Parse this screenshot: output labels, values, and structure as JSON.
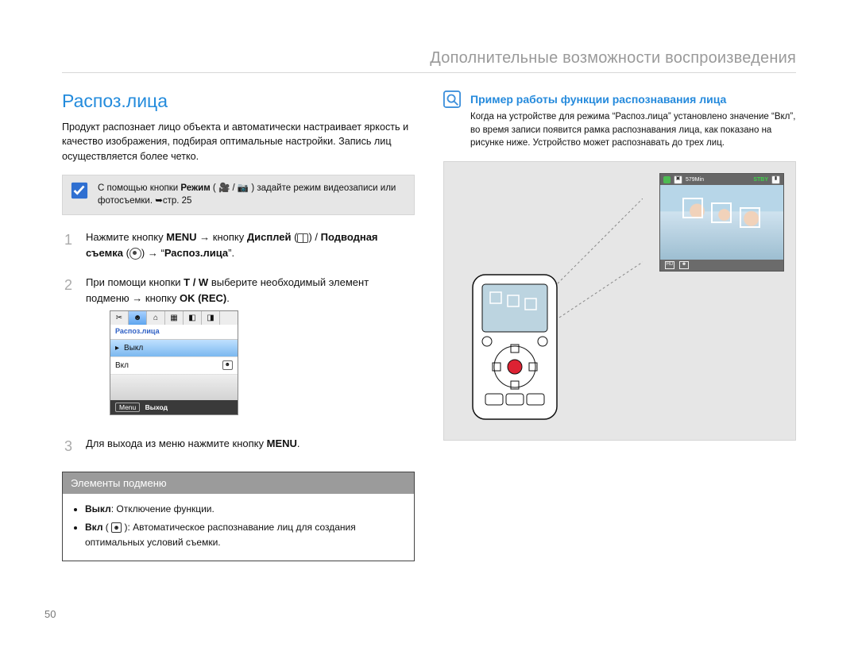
{
  "header": "Дополнительные возможности воспроизведения",
  "section_title": "Распоз.лица",
  "intro": "Продукт распознает лицо объекта и автоматически настраивает яркость и качество изображения, подбирая оптимальные настройки. Запись лиц осуществляется более четко.",
  "mode_note": {
    "prefix": "С помощью кнопки ",
    "bold1": "Режим",
    "glyph": " ( 🎥 / 📷 ) ",
    "rest": "задайте режим видеозаписи или фотосъемки. ➥стр. 25"
  },
  "steps": [
    {
      "num": "1",
      "parts": {
        "p1": "Нажмите кнопку ",
        "b1": "MENU",
        "p2": " → кнопку ",
        "b2": "Дисплей",
        "icon1": "display-icon",
        "p3": " / ",
        "b3": "Подводная съемка",
        "icon2": "dive-icon",
        "p4": " → “",
        "b4": "Распоз.лица",
        "p5": "”."
      }
    },
    {
      "num": "2",
      "parts": {
        "p1": "При помощи кнопки ",
        "b1": "T / W",
        "p2": " выберите необходимый элемент подменю → кнопку ",
        "b2": "OK (REC)",
        "p3": "."
      }
    },
    {
      "num": "3",
      "parts": {
        "p1": "Для выхода из меню нажмите кнопку ",
        "b1": "MENU",
        "p2": "."
      }
    }
  ],
  "menu_screenshot": {
    "title": "Распоз.лица",
    "item_off": "Выкл",
    "item_on": "Вкл",
    "exit": "Выход",
    "menu_label": "Menu"
  },
  "submenu": {
    "head": "Элементы подменю",
    "off_label": "Выкл",
    "off_text": ": Отключение функции.",
    "on_label": "Вкл",
    "on_text_pre": " ( ",
    "on_text": " ): Автоматическое распознавание лиц для создания оптимальных условий съемки."
  },
  "callout": {
    "title": "Пример работы функции распознавания лица",
    "text": "Когда на устройстве для режима “Распоз.лица” установлено значение “Вкл”, во время записи появится рамка распознавания лица, как показано на рисунке ниже. Устройство может распознавать до трех лиц."
  },
  "preview": {
    "time": "579Min",
    "stby": "STBY",
    "hd": "HD"
  },
  "page_number": "50"
}
